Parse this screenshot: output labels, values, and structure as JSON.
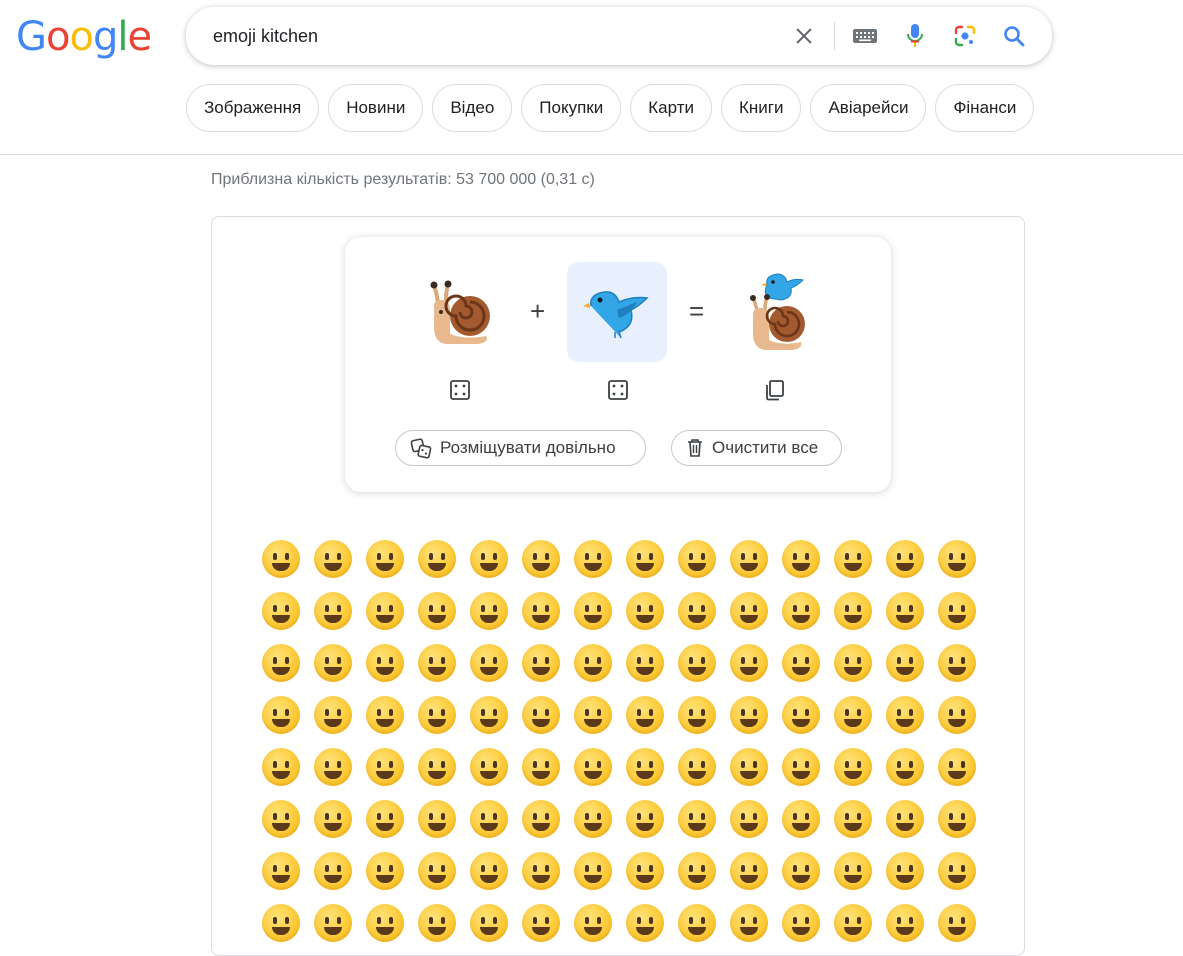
{
  "logo": {
    "letters": [
      {
        "ch": "G",
        "color": "#4285F4"
      },
      {
        "ch": "o",
        "color": "#EA4335"
      },
      {
        "ch": "o",
        "color": "#FBBC05"
      },
      {
        "ch": "g",
        "color": "#4285F4"
      },
      {
        "ch": "l",
        "color": "#34A853"
      },
      {
        "ch": "e",
        "color": "#EA4335"
      }
    ]
  },
  "search": {
    "query": "emoji kitchen",
    "icons": [
      "clear-icon",
      "keyboard-icon",
      "microphone-icon",
      "lens-icon",
      "search-icon"
    ]
  },
  "chips": [
    "Зображення",
    "Новини",
    "Відео",
    "Покупки",
    "Карти",
    "Книги",
    "Авіарейси",
    "Фінанси"
  ],
  "stats": "Приблизна кількість результатів: 53 700 000 (0,31 с)",
  "mixer": {
    "left_emoji": "snail",
    "right_emoji": "bird",
    "result_emoji": "snail-with-bird",
    "plus": "+",
    "equals": "=",
    "randomize_label": "Розміщувати довільно",
    "clear_label": "Очистити все"
  },
  "emoji_grid": [
    "😀",
    "😃",
    "😄",
    "😁",
    "😆",
    "😅",
    "😂",
    "🤣",
    "😭",
    "😉",
    "😗",
    "😙",
    "😚",
    "😘",
    "🥰",
    "😍",
    "🤩",
    "🥳",
    "🫠",
    "🙃",
    "🙂",
    "🥲",
    "🥹",
    "😊",
    "☺️",
    "😌",
    "😏",
    "😴",
    "😪",
    "🤤",
    "😋",
    "😛",
    "😝",
    "😜",
    "🤪",
    "🥴",
    "😔",
    "🥺",
    "😬",
    "😑",
    "😐",
    "😶",
    "😶‍🌫️",
    "🫥",
    "🤐",
    "🫡",
    "🤔",
    "🤫",
    "🫢",
    "🤭",
    "🥱",
    "🤗",
    "🫣",
    "😱",
    "🤨",
    "🧐",
    "😒",
    "🙄",
    "😮‍💨",
    "😤",
    "😠",
    "😡",
    "🤬",
    "😞",
    "😓",
    "😟",
    "😥",
    "😢",
    "☹️",
    "🙁",
    "🫤",
    "😕",
    "😰",
    "😨",
    "😧",
    "😦",
    "😮",
    "😯",
    "😲",
    "😳",
    "🤯",
    "😖",
    "😣",
    "😩",
    "😫",
    "😵",
    "🥶",
    "🥵",
    "🤢",
    "🤮",
    "🤧",
    "🤒",
    "🤕",
    "😷",
    "🤥",
    "😇",
    "🤠",
    "🤑",
    "🤓",
    "😎",
    "🥸",
    "🤡",
    "😈",
    "👿",
    "👻",
    "🎃",
    "💩",
    "🤖",
    "👽",
    "👾",
    "🌛",
    "🌜"
  ]
}
